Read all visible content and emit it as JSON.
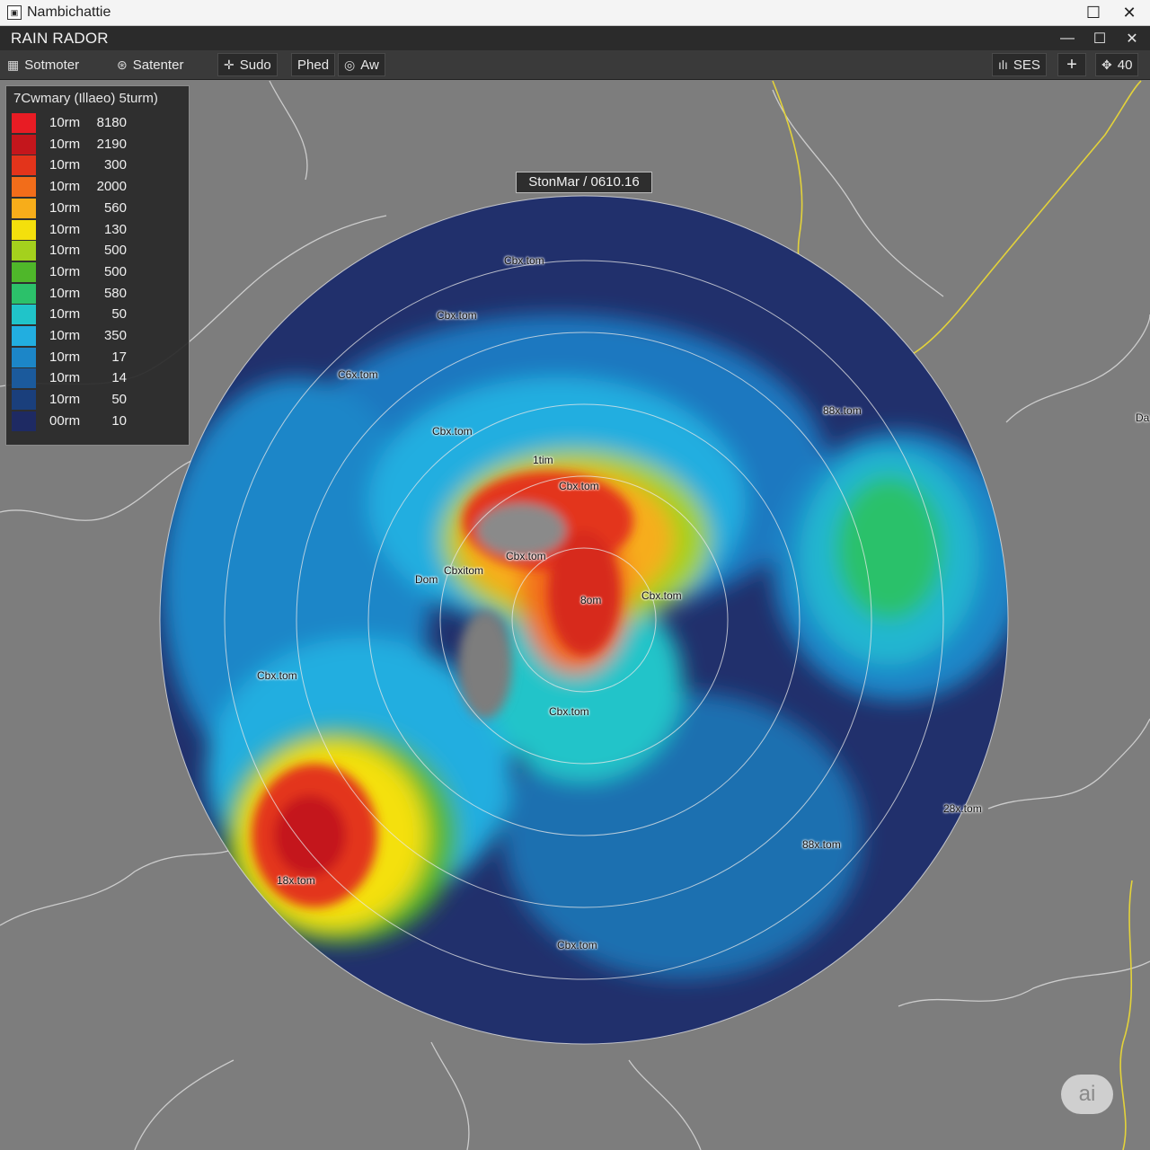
{
  "window": {
    "title": "Nambichattie",
    "app_title": "RAIN RADOR"
  },
  "toolbar": [
    {
      "label": "Sotmoter",
      "icon": "layers-icon"
    },
    {
      "label": "Satenter",
      "icon": "satellite-icon"
    },
    {
      "label": "Sudo",
      "icon": "crosshair-icon"
    },
    {
      "label": "Phed",
      "icon": ""
    },
    {
      "label": "Aw",
      "icon": "target-icon"
    }
  ],
  "toolbar_right": {
    "ses_label": "SES",
    "zoom_label": "40"
  },
  "legend": {
    "title": "7Cwmary (Illaeo) 5turm)",
    "items": [
      {
        "label": "10rm",
        "value": "8180",
        "color": "#e81c24"
      },
      {
        "label": "10rm",
        "value": "2190",
        "color": "#c4161c"
      },
      {
        "label": "10rm",
        "value": "300",
        "color": "#e3341b"
      },
      {
        "label": "10rm",
        "value": "2000",
        "color": "#f26d1a"
      },
      {
        "label": "10rm",
        "value": "560",
        "color": "#f7ad1a"
      },
      {
        "label": "10rm",
        "value": "130",
        "color": "#f4e00c"
      },
      {
        "label": "10rm",
        "value": "500",
        "color": "#a4d11d"
      },
      {
        "label": "10rm",
        "value": "500",
        "color": "#4fb72a"
      },
      {
        "label": "10rm",
        "value": "580",
        "color": "#2cc16a"
      },
      {
        "label": "10rm",
        "value": "50",
        "color": "#20c4c9"
      },
      {
        "label": "10rm",
        "value": "350",
        "color": "#22aee0"
      },
      {
        "label": "10rm",
        "value": "17",
        "color": "#1c86c8"
      },
      {
        "label": "10rm",
        "value": "14",
        "color": "#1b5a9c"
      },
      {
        "label": "10rm",
        "value": "50",
        "color": "#1a3f7c"
      },
      {
        "label": "00rm",
        "value": "10",
        "color": "#1e2a63"
      }
    ]
  },
  "tooltip": "StonMar / 0610.16",
  "map_labels": [
    "Cbx.tom",
    "Cbx.tom",
    "C6x.tom",
    "88x.tom",
    "Cbx.tom",
    "1tim",
    "Cbx.tom",
    "Cbx.tom",
    "Cbxitom",
    "Dom",
    "8om",
    "Cbx.tom",
    "Cbx.tom",
    "Cbx.tom",
    "28x.tom",
    "88x.tom",
    "18x.tom",
    "Cbx.tom",
    "Da"
  ],
  "watermark": "ai"
}
